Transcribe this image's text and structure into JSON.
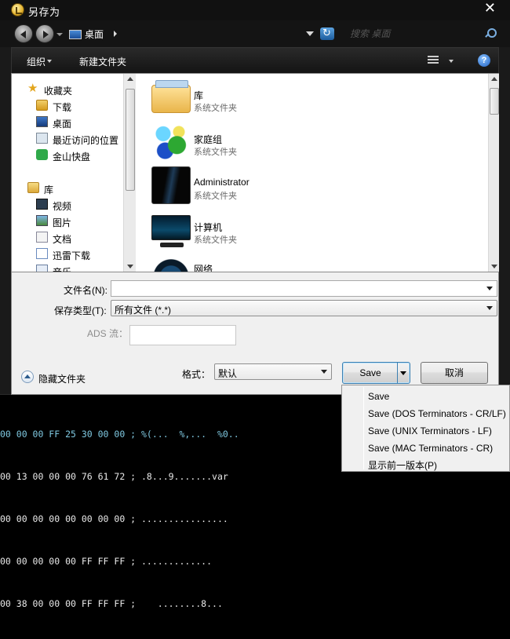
{
  "window": {
    "title": "另存为",
    "close_glyph": "✕"
  },
  "address": {
    "location": "桌面",
    "search_placeholder": "搜索 桌面"
  },
  "toolbar": {
    "organize_label": "组织",
    "new_folder_label": "新建文件夹",
    "help_glyph": "?"
  },
  "nav_pane": {
    "items": [
      {
        "label": "收藏夹",
        "icon": "star-icon"
      },
      {
        "label": "下载",
        "icon": "download-folder-icon"
      },
      {
        "label": "桌面",
        "icon": "desktop-icon"
      },
      {
        "label": "最近访问的位置",
        "icon": "recent-places-icon"
      },
      {
        "label": "金山快盘",
        "icon": "jinshan-kuaipan-icon"
      },
      {
        "label": "库",
        "icon": "library-icon"
      },
      {
        "label": "视频",
        "icon": "video-library-icon"
      },
      {
        "label": "图片",
        "icon": "pictures-library-icon"
      },
      {
        "label": "文档",
        "icon": "documents-library-icon"
      },
      {
        "label": "迅雷下载",
        "icon": "xunlei-download-icon"
      },
      {
        "label": "音乐",
        "icon": "music-library-icon"
      }
    ]
  },
  "files": [
    {
      "name": "库",
      "description": "系统文件夹",
      "icon": "library-folder-icon"
    },
    {
      "name": "家庭组",
      "description": "系统文件夹",
      "icon": "homegroup-icon"
    },
    {
      "name": "Administrator",
      "description": "系统文件夹",
      "icon": "user-folder-icon"
    },
    {
      "name": "计算机",
      "description": "系统文件夹",
      "icon": "computer-icon"
    },
    {
      "name": "网络",
      "description": "",
      "icon": "network-icon"
    }
  ],
  "form": {
    "filename_label": "文件名(N):",
    "filename_value": "",
    "filetype_label": "保存类型(T):",
    "filetype_value": "所有文件 (*.*)",
    "ads_label": "ADS 流：",
    "ads_value": "",
    "format_label": "格式：",
    "format_value": "默认",
    "hide_folders_label": "隐藏文件夹",
    "save_label": "Save",
    "cancel_label": "取消"
  },
  "save_menu": {
    "items": [
      "Save",
      "Save (DOS Terminators - CR/LF)",
      "Save (UNIX Terminators - LF)",
      "Save (MAC Terminators - CR)",
      "显示前一版本(P)"
    ]
  },
  "hex_background": {
    "lines": [
      "00 00 00 FF 25 30 00 00 ; %(...  %,...  %0..",
      "00 13 00 00 00 76 61 72 ; .8...9.......var",
      "00 00 00 00 00 00 00 00 ; ................",
      "00 00 00 00 00 FF FF FF ; .............",
      "00 38 00 00 00 FF FF FF ;    ........8..."
    ]
  }
}
